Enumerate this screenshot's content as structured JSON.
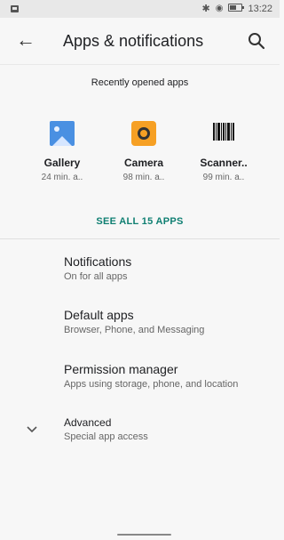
{
  "status_bar": {
    "time": "13:22",
    "icons": [
      "image-icon",
      "bluetooth-icon",
      "cast-icon",
      "battery-icon"
    ]
  },
  "header": {
    "title": "Apps & notifications",
    "back_icon": "arrow-left-icon",
    "search_icon": "search-icon"
  },
  "recent": {
    "title": "Recently opened apps",
    "apps": [
      {
        "name": "Gallery",
        "time": "24 min. a..",
        "icon": "gallery-icon"
      },
      {
        "name": "Camera",
        "time": "98 min. a..",
        "icon": "camera-icon"
      },
      {
        "name": "Scanner..",
        "time": "99 min. a..",
        "icon": "scanner-icon"
      }
    ],
    "see_all": "SEE ALL 15 APPS"
  },
  "menu": [
    {
      "title": "Notifications",
      "subtitle": "On for all apps"
    },
    {
      "title": "Default apps",
      "subtitle": "Browser, Phone, and Messaging"
    },
    {
      "title": "Permission manager",
      "subtitle": "Apps using storage, phone, and location"
    },
    {
      "title": "Advanced",
      "subtitle": "Special app access",
      "icon": "chevron-down-icon"
    }
  ],
  "colors": {
    "accent": "#0f7f72",
    "background": "#f7f7f7"
  }
}
